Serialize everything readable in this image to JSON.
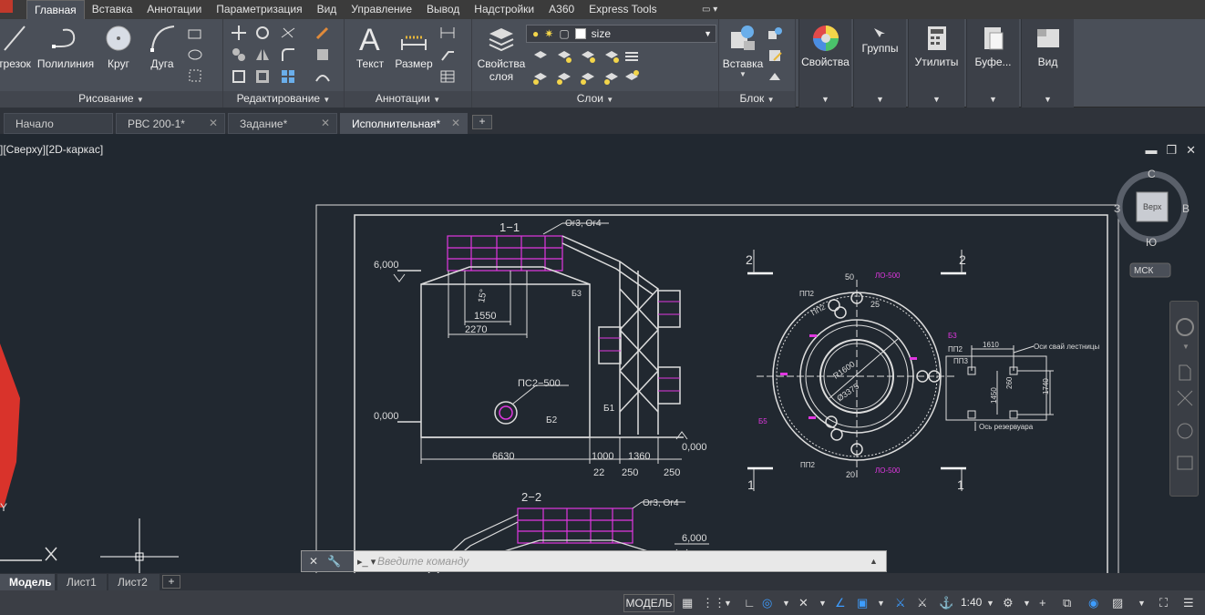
{
  "ribbon_tabs": [
    "Главная",
    "Вставка",
    "Аннотации",
    "Параметризация",
    "Вид",
    "Управление",
    "Вывод",
    "Надстройки",
    "A360",
    "Express Tools"
  ],
  "active_ribbon_tab": "Главная",
  "draw_panel": {
    "title": "Рисование",
    "buttons": {
      "line": "трезок",
      "polyline": "Полилиния",
      "circle": "Круг",
      "arc": "Дуга"
    }
  },
  "modify_panel": {
    "title": "Редактирование"
  },
  "annotation_panel": {
    "title": "Аннотации",
    "text": "Текст",
    "dimension": "Размер"
  },
  "layers_panel": {
    "title": "Слои",
    "properties_line1": "Свойства",
    "properties_line2": "слоя",
    "current_layer": "size"
  },
  "block_panel": {
    "title": "Блок",
    "insert": "Вставка"
  },
  "extra_panels": {
    "properties": "Свойства",
    "groups": "Группы",
    "utilities": "Утилиты",
    "clipboard": "Буфе...",
    "view": "Вид"
  },
  "doc_tabs": [
    {
      "label": "Начало",
      "closable": false
    },
    {
      "label": "РВС 200-1*",
      "closable": true
    },
    {
      "label": "Задание*",
      "closable": true
    },
    {
      "label": "Исполнительная*",
      "closable": true
    }
  ],
  "active_doc_tab": "Исполнительная*",
  "viewport_label": "][Сверху][2D-каркас]",
  "viewcube": {
    "north": "С",
    "south": "Ю",
    "west": "З",
    "east": "В",
    "face": "Верх",
    "ucs": "МСК"
  },
  "command_line": {
    "placeholder": "Введите команду"
  },
  "layout_tabs": [
    "Модель",
    "Лист1",
    "Лист2"
  ],
  "active_layout_tab": "Модель",
  "status_bar": {
    "model": "МОДЕЛЬ",
    "scale": "1:40"
  },
  "drawing": {
    "section_1_title": "1−1",
    "section_2_title": "2−2",
    "og_label": "Ог3, Ог4",
    "elev_6": "6,000",
    "elev_0": "0,000",
    "elev_0_right": "0,000",
    "dim_1550": "1550",
    "dim_2270": "2270",
    "dim_15": "15°",
    "ps_label": "ПС2−500",
    "b1": "Б1",
    "b2": "Б2",
    "b3": "Б3",
    "dim_6630": "6630",
    "dim_1000": "1000",
    "dim_1360": "1360",
    "dim_22": "22",
    "dim_250a": "250",
    "dim_250b": "250",
    "section_mark_2": "2",
    "section_mark_1": "1",
    "pp2": "ПП2",
    "pp3": "ПП3",
    "lo500": "ЛО-500",
    "dim_50": "50",
    "dim_25": "25",
    "dim_20": "20",
    "r1600": "R1600",
    "d3375": "Ø3375",
    "dim_1610": "1610",
    "dim_1450": "1450",
    "dim_1740": "1740",
    "dim_260": "260",
    "axis_stair": "Оси свай лестницы",
    "axis_tank": "Ось резервуара"
  }
}
